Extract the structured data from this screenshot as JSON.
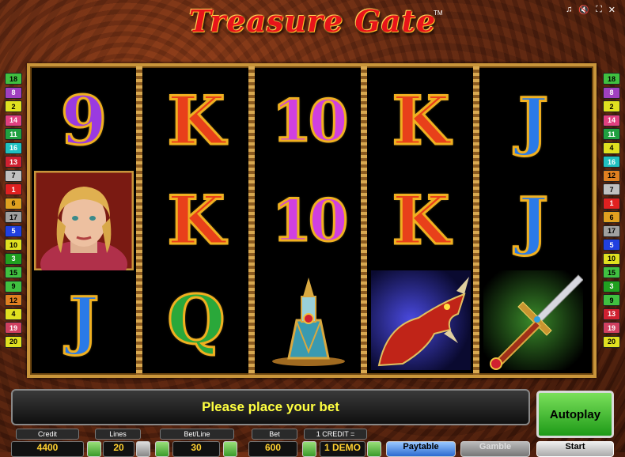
{
  "game": {
    "title": "Treasure Gate",
    "tm": "TM"
  },
  "top_icons": [
    "music-icon",
    "sound-icon",
    "fullscreen-icon",
    "close-icon"
  ],
  "paylines_left": [
    "18",
    "8",
    "2",
    "14",
    "11",
    "16",
    "13",
    "7",
    "1",
    "6",
    "17",
    "5",
    "10",
    "3",
    "15",
    "9",
    "12",
    "4",
    "19",
    "20"
  ],
  "paylines_right": [
    "18",
    "8",
    "2",
    "14",
    "11",
    "4",
    "16",
    "12",
    "7",
    "1",
    "6",
    "17",
    "5",
    "10",
    "15",
    "3",
    "9",
    "13",
    "19",
    "20"
  ],
  "payline_colors": {
    "1": "#e02020",
    "2": "#e0e020",
    "3": "#20a020",
    "4": "#e0e020",
    "5": "#2040e0",
    "6": "#e0a020",
    "7": "#c0c0c0",
    "8": "#a040c0",
    "9": "#40c040",
    "10": "#e0e020",
    "11": "#20a040",
    "12": "#e08020",
    "13": "#d02030",
    "14": "#e04080",
    "15": "#40c040",
    "16": "#20c0c0",
    "17": "#a0a0a0",
    "18": "#40c040",
    "19": "#d04060",
    "20": "#e0e020"
  },
  "reels": [
    [
      "9",
      "woman-portrait",
      "J"
    ],
    [
      "K",
      "K",
      "Q"
    ],
    [
      "10",
      "10",
      "potion-bottle"
    ],
    [
      "K",
      "K",
      "dragon"
    ],
    [
      "J",
      "J",
      "sword"
    ]
  ],
  "message": "Please place your bet",
  "autoplay_label": "Autoplay",
  "labels": {
    "credit": "Credit",
    "lines": "Lines",
    "bet_line": "Bet/Line",
    "bet": "Bet",
    "credit_rate": "1 CREDIT ="
  },
  "values": {
    "credit": "4400",
    "lines": "20",
    "bet_line": "30",
    "bet": "600",
    "demo": "1 DEMO"
  },
  "buttons": {
    "paytable": "Paytable",
    "gamble": "Gamble",
    "start": "Start"
  }
}
